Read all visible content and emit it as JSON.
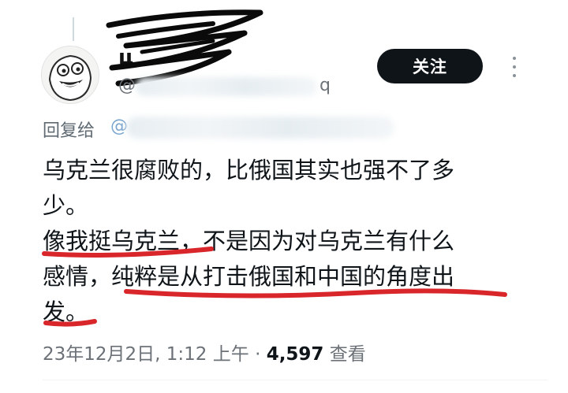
{
  "tweet": {
    "author_name_visible": "ц",
    "handle_prefix": "@",
    "handle_suffix": "q",
    "follow_label": "关注",
    "reply_label": "回复给",
    "reply_at": "@",
    "body_lines": [
      "乌克兰很腐败的，比俄国其实也强不了多",
      "少。",
      "像我挺乌克兰，不是因为对乌克兰有什么",
      "感情，纯粹是从打击俄国和中国的角度出",
      "发。"
    ],
    "timestamp": "23年12月2日, 1:12 上午",
    "separator": "·",
    "views_count": "4,597",
    "views_label": "查看"
  },
  "colors": {
    "annotation_red": "#d8262b",
    "follow_bg": "#0f1419",
    "muted_text": "#6b7177"
  }
}
